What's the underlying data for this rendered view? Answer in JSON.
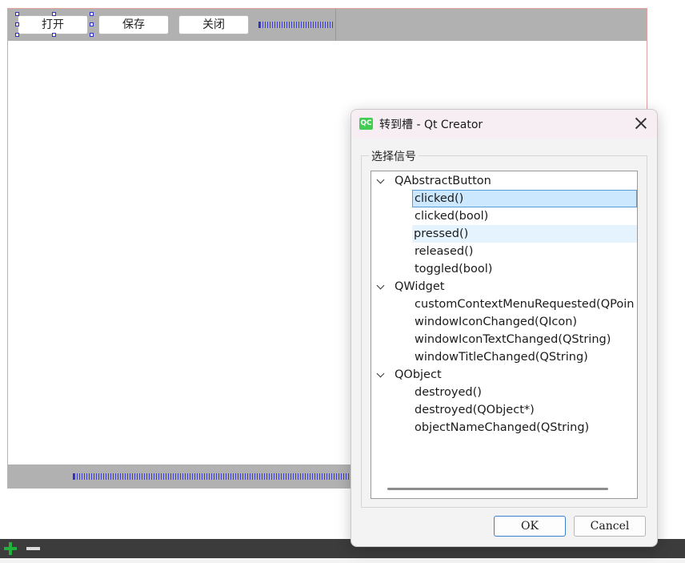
{
  "form": {
    "toolbar_buttons": [
      "打开",
      "保存",
      "关闭"
    ]
  },
  "dialog": {
    "title": "转到槽 - Qt Creator",
    "icon_text": "QC",
    "group_label": "选择信号",
    "tree": [
      {
        "class": "QAbstractButton",
        "signals": [
          "clicked()",
          "clicked(bool)",
          "pressed()",
          "released()",
          "toggled(bool)"
        ]
      },
      {
        "class": "QWidget",
        "signals": [
          "customContextMenuRequested(QPoin",
          "windowIconChanged(QIcon)",
          "windowIconTextChanged(QString)",
          "windowTitleChanged(QString)"
        ]
      },
      {
        "class": "QObject",
        "signals": [
          "destroyed()",
          "destroyed(QObject*)",
          "objectNameChanged(QString)"
        ]
      }
    ],
    "selected_signal": "clicked()",
    "ok_label": "OK",
    "cancel_label": "Cancel"
  },
  "colors": {
    "selection": "#cce8ff",
    "qt_green": "#41cd52",
    "toolbar_gray": "#b1b1b1"
  }
}
